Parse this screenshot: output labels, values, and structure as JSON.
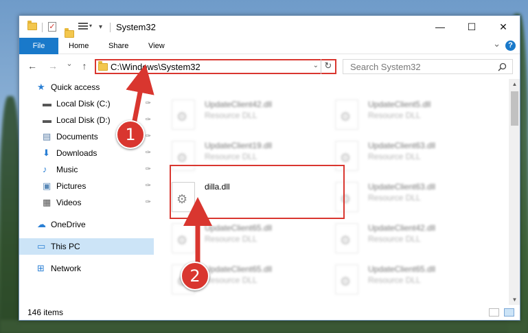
{
  "window": {
    "title": "System32",
    "minimize_glyph": "—",
    "maximize_glyph": "☐",
    "close_glyph": "✕"
  },
  "ribbon": {
    "tabs": [
      "File",
      "Home",
      "Share",
      "View"
    ],
    "expand_glyph": "⌄",
    "help_glyph": "?"
  },
  "navigation": {
    "back_glyph": "←",
    "forward_glyph": "→",
    "recent_glyph": "⌄",
    "up_glyph": "↑",
    "address_path": "C:\\Windows\\System32",
    "address_dropdown_glyph": "⌄",
    "refresh_glyph": "↻",
    "search_placeholder": "Search System32",
    "search_icon": "search-icon"
  },
  "sidebar": {
    "items": [
      {
        "label": "Quick access",
        "icon": "star-icon",
        "pinned": false
      },
      {
        "label": "Local Disk (C:)",
        "icon": "drive-icon",
        "pinned": true
      },
      {
        "label": "Local Disk (D:)",
        "icon": "drive-icon",
        "pinned": true
      },
      {
        "label": "Documents",
        "icon": "document-icon",
        "pinned": true
      },
      {
        "label": "Downloads",
        "icon": "download-icon",
        "pinned": true
      },
      {
        "label": "Music",
        "icon": "music-icon",
        "pinned": true
      },
      {
        "label": "Pictures",
        "icon": "picture-icon",
        "pinned": true
      },
      {
        "label": "Videos",
        "icon": "video-icon",
        "pinned": true
      },
      {
        "label": "OneDrive",
        "icon": "cloud-icon",
        "pinned": false
      },
      {
        "label": "This PC",
        "icon": "computer-icon",
        "pinned": false,
        "selected": true
      },
      {
        "label": "Network",
        "icon": "network-icon",
        "pinned": false
      }
    ],
    "pin_glyph": "📌"
  },
  "files": [
    {
      "name": "UpdateClient42.dll",
      "type": "Resource DLL",
      "blurred": true
    },
    {
      "name": "UpdateClient5.dll",
      "type": "Resource DLL",
      "blurred": true
    },
    {
      "name": "UpdateClient19.dll",
      "type": "Resource DLL",
      "blurred": true
    },
    {
      "name": "UpdateClient63.dll",
      "type": "Resource DLL",
      "blurred": true
    },
    {
      "name": "dilla.dll",
      "type": "",
      "blurred": false
    },
    {
      "name": "UpdateClient63.dll",
      "type": "Resource DLL",
      "blurred": true
    },
    {
      "name": "UpdateClient65.dll",
      "type": "Resource DLL",
      "blurred": true
    },
    {
      "name": "UpdateClient42.dll",
      "type": "Resource DLL",
      "blurred": true
    },
    {
      "name": "UpdateClient65.dll",
      "type": "Resource DLL",
      "blurred": true
    },
    {
      "name": "UpdateClient65.dll",
      "type": "Resource DLL",
      "blurred": true
    }
  ],
  "status": {
    "item_count": "146 items"
  },
  "callouts": [
    {
      "number": "1"
    },
    {
      "number": "2"
    }
  ],
  "colors": {
    "accent": "#1979ca",
    "callout_red": "#d9362f",
    "selection": "#cce4f7"
  }
}
